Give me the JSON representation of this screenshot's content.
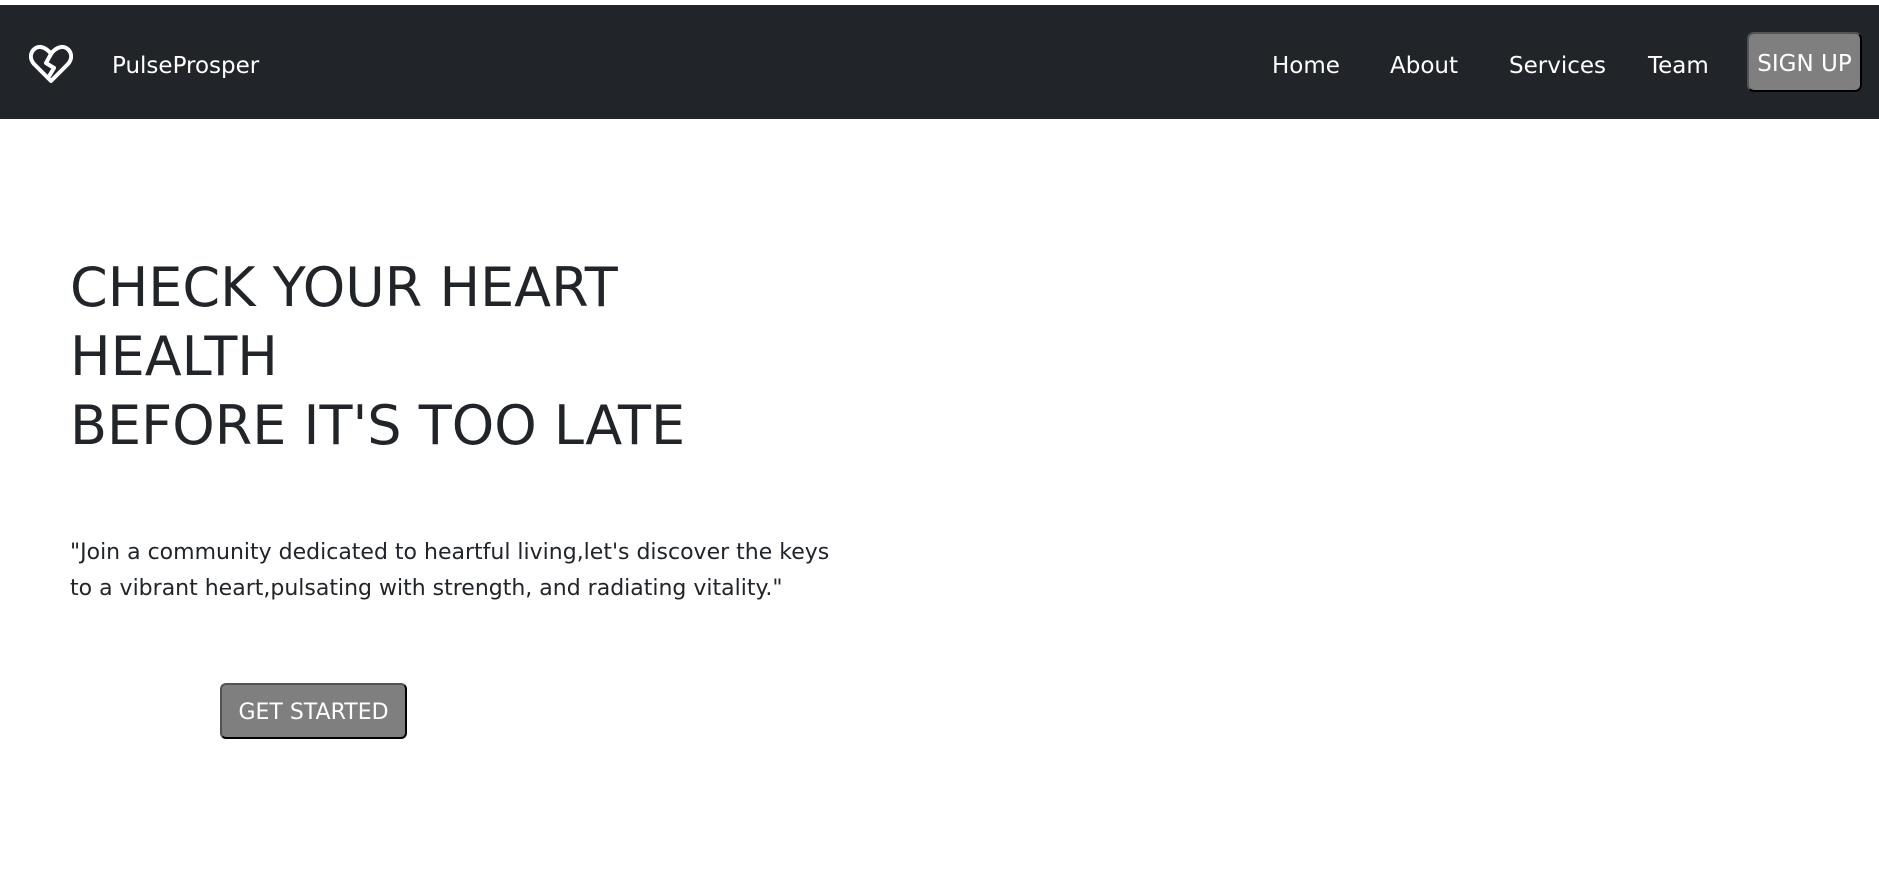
{
  "navbar": {
    "brand_icon": "broken-heart-logo-icon",
    "brand_name": "PulseProsper",
    "links": [
      {
        "label": "Home"
      },
      {
        "label": "About"
      },
      {
        "label": "Services"
      },
      {
        "label": "Team"
      }
    ],
    "signup_label": "SIGN UP"
  },
  "hero": {
    "title_lines": [
      "CHECK YOUR HEART",
      "HEALTH",
      "BEFORE IT'S TOO LATE"
    ],
    "quote_lines": [
      "\"Join a community dedicated to heartful living,let's discover the keys",
      "to a vibrant heart,pulsating with strength, and radiating vitality.\""
    ],
    "cta_label": "GET STARTED"
  },
  "colors": {
    "navbar_bg": "#212529",
    "button_bg": "#7f7f7f",
    "text": "#212529",
    "page_bg": "#ffffff"
  }
}
